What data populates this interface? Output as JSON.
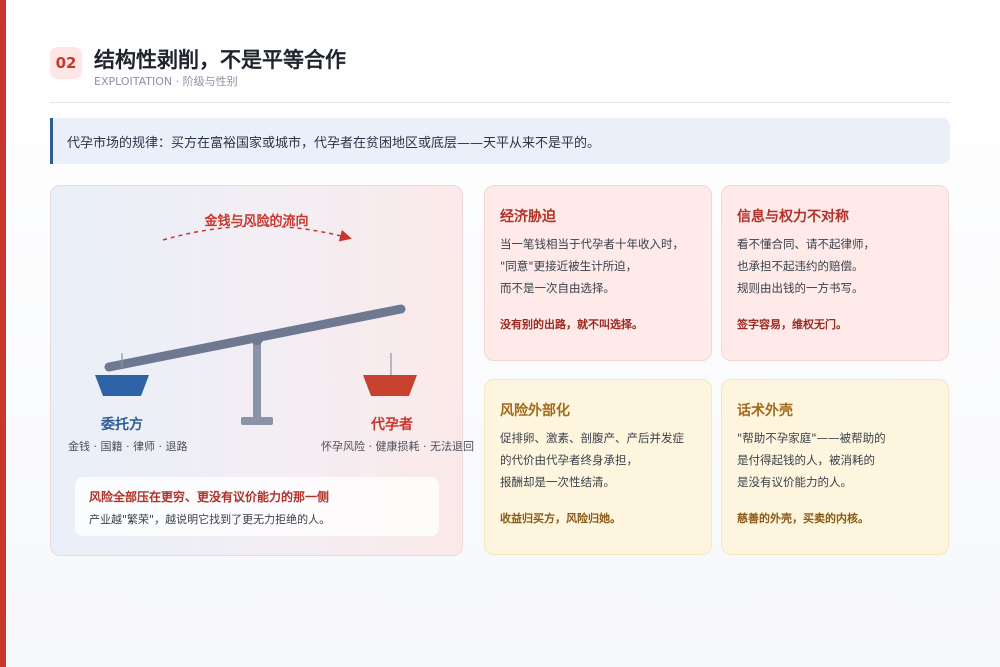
{
  "header": {
    "number": "02",
    "title": "结构性剥削，不是平等合作",
    "subtitle": "EXPLOITATION · 阶级与性别"
  },
  "callout": {
    "text": "代孕市场的规律：买方在富裕国家或城市，代孕者在贫困地区或底层——天平从来不是平的。"
  },
  "scale": {
    "flow_label": "金钱与风险的流向",
    "left": {
      "label": "委托方",
      "sub": "金钱 · 国籍 · 律师 · 退路",
      "color": "#2e63a8"
    },
    "right": {
      "label": "代孕者",
      "sub": "怀孕风险 · 健康损耗 · 无法退回",
      "color": "#c8432f"
    },
    "risk_title": "风险全部压在更穷、更没有议价能力的那一侧",
    "risk_text": "产业越\"繁荣\"，越说明它找到了更无力拒绝的人。"
  },
  "cards": [
    {
      "title": "经济胁迫",
      "lines": [
        "当一笔钱相当于代孕者十年收入时，",
        "\"同意\"更接近被生计所迫，",
        "而不是一次自由选择。"
      ],
      "conclusion": "没有别的出路，就不叫选择。"
    },
    {
      "title": "信息与权力不对称",
      "lines": [
        "看不懂合同、请不起律师，",
        "也承担不起违约的赔偿。",
        "规则由出钱的一方书写。"
      ],
      "conclusion": "签字容易，维权无门。"
    },
    {
      "title": "风险外部化",
      "lines": [
        "促排卵、激素、剖腹产、产后并发症",
        "的代价由代孕者终身承担，",
        "报酬却是一次性结清。"
      ],
      "conclusion": "收益归买方，风险归她。"
    },
    {
      "title": "话术外壳",
      "lines": [
        "\"帮助不孕家庭\"——被帮助的",
        "是付得起钱的人，被消耗的",
        "是没有议价能力的人。"
      ],
      "conclusion": "慈善的外壳，买卖的内核。"
    }
  ],
  "colors": {
    "accent": "#c8372d",
    "blue": "#2e5d93"
  }
}
